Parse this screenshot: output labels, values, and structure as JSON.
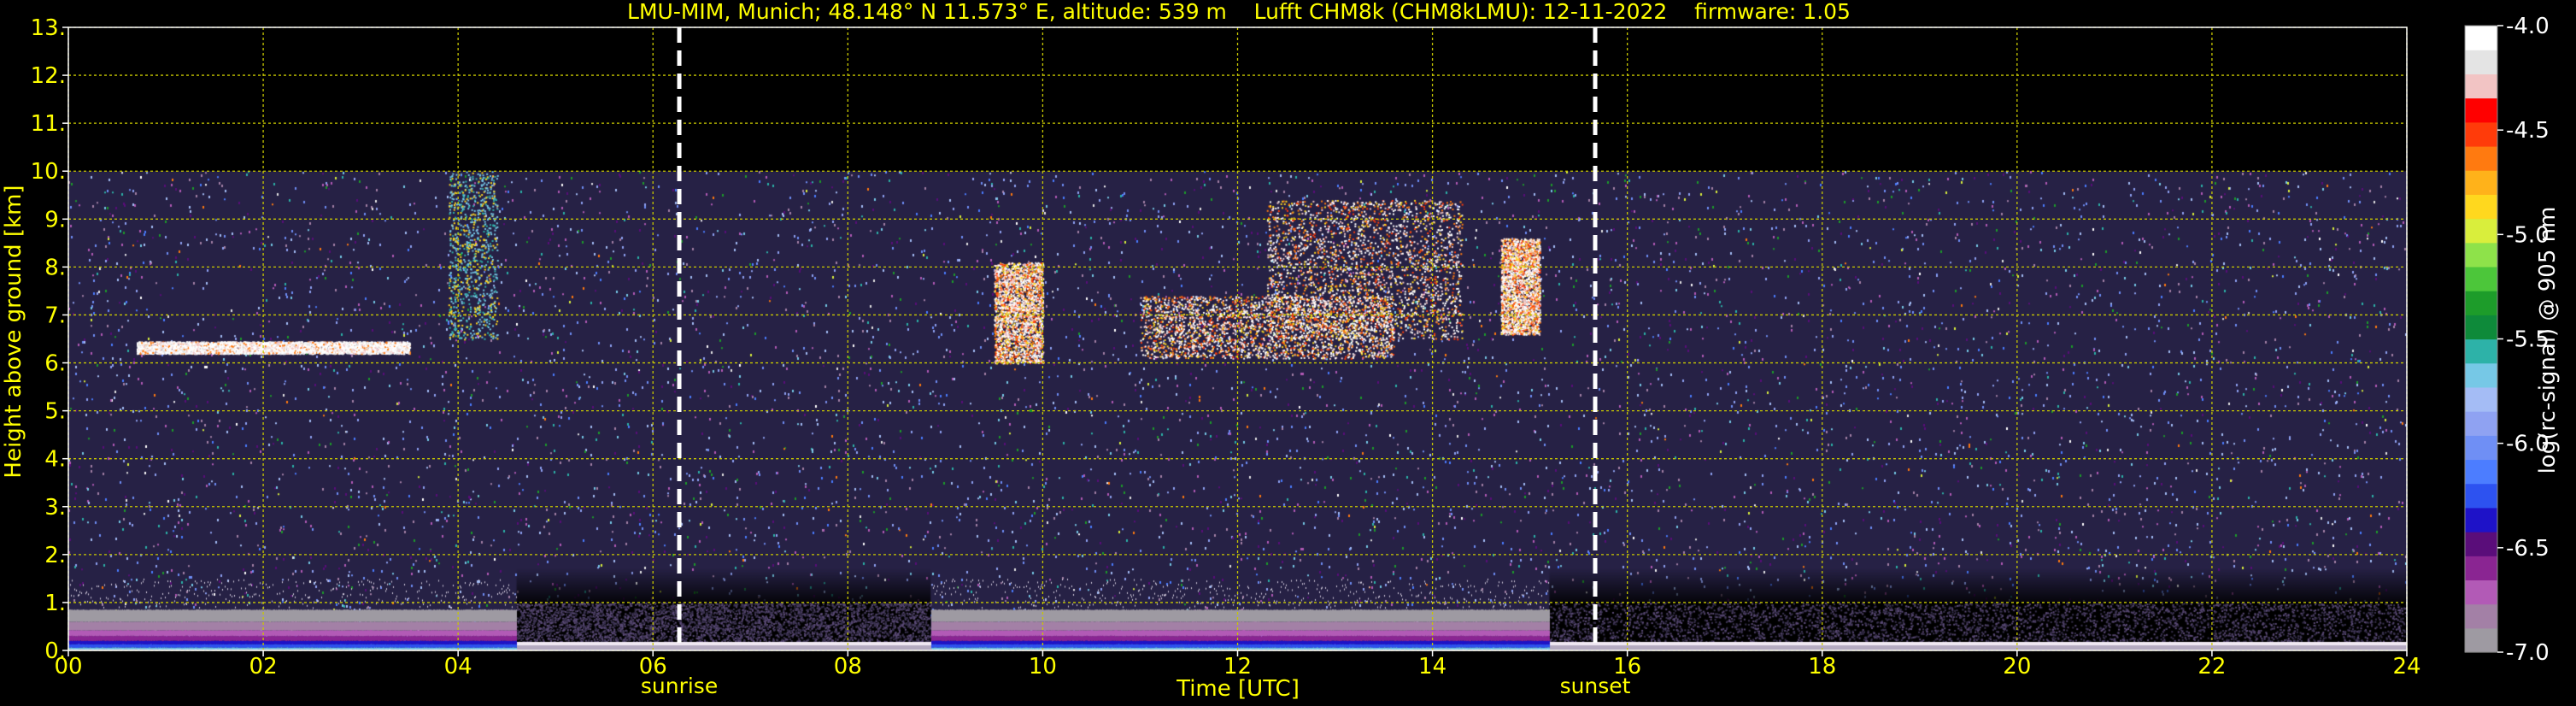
{
  "chart_data": {
    "type": "heatmap",
    "title": "LMU-MIM, Munich; 48.148° N 11.573° E, altitude: 539 m    Lufft CHM8k (CHM8kLMU): 12-11-2022    firmware: 1.05",
    "xlabel": "Time [UTC]",
    "ylabel": "Height above ground [km]",
    "xlim": [
      0,
      24
    ],
    "ylim": [
      0,
      13
    ],
    "x_ticks": [
      0,
      2,
      4,
      6,
      8,
      10,
      12,
      14,
      16,
      18,
      20,
      22,
      24
    ],
    "x_tick_labels": [
      "00",
      "02",
      "04",
      "06",
      "08",
      "10",
      "12",
      "14",
      "16",
      "18",
      "20",
      "22",
      "24"
    ],
    "y_ticks": [
      0,
      1,
      2,
      3,
      4,
      5,
      6,
      7,
      8,
      9,
      10,
      11,
      12,
      13
    ],
    "y_tick_labels": [
      "0.",
      "1.",
      "2.",
      "3.",
      "4.",
      "5.",
      "6.",
      "7.",
      "8.",
      "9.",
      "10.",
      "11.",
      "12.",
      "13."
    ],
    "grid": true,
    "data_top_km": 10,
    "markers": [
      {
        "label": "sunrise",
        "time": 6.27
      },
      {
        "label": "sunset",
        "time": 15.67
      }
    ],
    "colorbar": {
      "label": "log(rc-signal) @ 905 nm",
      "range": [
        -7.0,
        -4.0
      ],
      "ticks": [
        -4.0,
        -4.5,
        -5.0,
        -5.5,
        -6.0,
        -6.5,
        -7.0
      ],
      "tick_labels": [
        "-4.0",
        "-4.5",
        "-5.0",
        "-5.5",
        "-6.0",
        "-6.5",
        "-7.0"
      ]
    },
    "colormap": [
      "#9e9aa2",
      "#a380a6",
      "#b25ab6",
      "#8a2592",
      "#5a0d7a",
      "#1e12c8",
      "#2d52f0",
      "#4c7dff",
      "#6f8ff5",
      "#8fa2f2",
      "#a4bcf5",
      "#76c8e6",
      "#2db2a8",
      "#0e8a3a",
      "#1d9c2a",
      "#4cc63a",
      "#8ee24a",
      "#d9ee3c",
      "#ffd81e",
      "#ffb21a",
      "#ff7a10",
      "#ff3b0a",
      "#ff0000",
      "#f2c4c4",
      "#e4e4e4",
      "#ffffff"
    ],
    "low_signal_blocks": [
      {
        "t_start": 4.6,
        "t_end": 8.85,
        "h_top": 1.0
      },
      {
        "t_start": 15.2,
        "t_end": 24.0,
        "h_top": 1.0
      }
    ],
    "cloud_features": [
      {
        "t_start": 0.7,
        "t_end": 3.5,
        "h_base": 6.2,
        "h_top": 6.45
      },
      {
        "t_start": 9.5,
        "t_end": 10.0,
        "h_base": 6.0,
        "h_top": 8.1
      },
      {
        "t_start": 11.0,
        "t_end": 13.6,
        "h_base": 6.1,
        "h_top": 7.4
      },
      {
        "t_start": 12.3,
        "t_end": 14.3,
        "h_base": 6.5,
        "h_top": 9.4
      },
      {
        "t_start": 14.7,
        "t_end": 15.1,
        "h_base": 6.6,
        "h_top": 8.6
      },
      {
        "t_start": 3.9,
        "t_end": 4.4,
        "h_base": 6.5,
        "h_top": 10.0
      }
    ]
  }
}
